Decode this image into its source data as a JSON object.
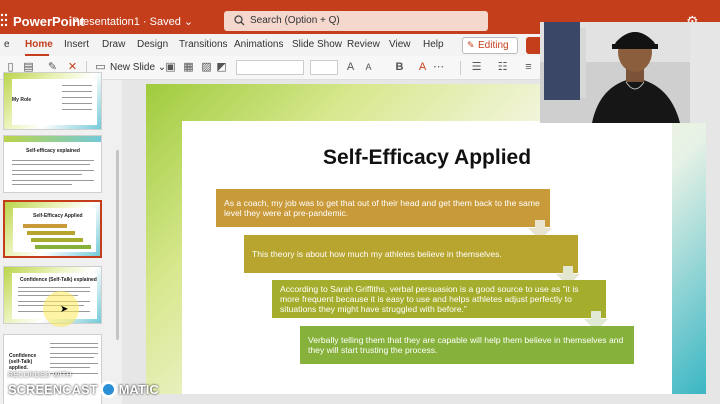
{
  "titlebar": {
    "app_name": "PowerPoint",
    "doc_title": "Presentation1  ·  Saved ⌄",
    "search_placeholder": "Search (Option + Q)"
  },
  "ribbon": {
    "tabs": [
      "Home",
      "Insert",
      "Draw",
      "Design",
      "Transitions",
      "Animations",
      "Slide Show",
      "Review",
      "View",
      "Help"
    ],
    "active_tab": "Home",
    "editing_label": "Editing ⌄"
  },
  "toolbar": {
    "new_slide_label": "New Slide ⌄",
    "bold_label": "B",
    "font_color_label": "A"
  },
  "thumbnails": [
    {
      "title": "My Role"
    },
    {
      "title": "Self-efficacy explained"
    },
    {
      "title": "Self-Efficacy Applied"
    },
    {
      "title": "Confidence (Self-Talk) explained"
    },
    {
      "title": "Confidence (self-Talk) applied."
    }
  ],
  "slide": {
    "title": "Self-Efficacy Applied",
    "steps": [
      {
        "text": "As a coach, my job was to get that out of their head and get them back to the same level they were at pre-pandemic.",
        "color": "#c99a3a"
      },
      {
        "text": "This theory is about how much my athletes believe in themselves.",
        "color": "#b8a52f"
      },
      {
        "text": "According to Sarah Griffiths, verbal persuasion is a good source to use as \"it is more frequent because it is easy to use and helps athletes adjust perfectly to situations they might have struggled with before.\"",
        "color": "#a4ad2c"
      },
      {
        "text": "Verbally telling them that they are capable will help them believe in themselves and they will start trusting the process.",
        "color": "#86b13a"
      }
    ]
  },
  "watermark": {
    "line1": "RECORDED WITH",
    "line2a": "SCREENCAST",
    "line2b": "MATIC"
  }
}
